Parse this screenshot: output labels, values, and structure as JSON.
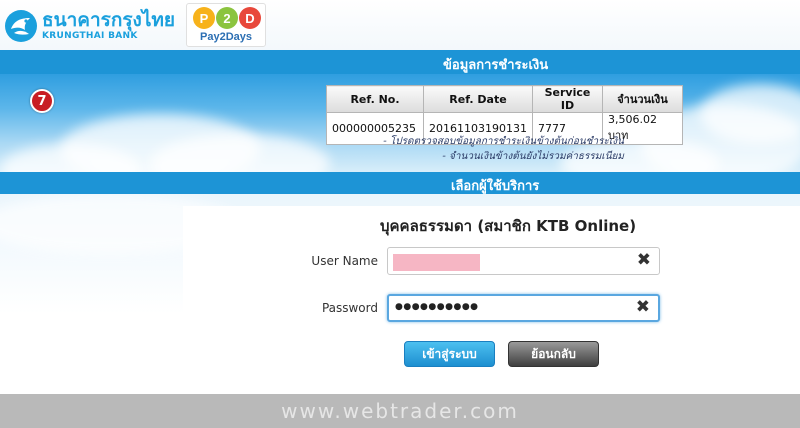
{
  "header": {
    "bank_name_th": "ธนาคารกรุงไทย",
    "bank_name_en": "KRUNGTHAI BANK",
    "p2d_letters": [
      "P",
      "2",
      "D"
    ],
    "p2d_colors": [
      "#f7b21b",
      "#8bc43f",
      "#e8483b"
    ],
    "p2d_tagline": "Pay2Days"
  },
  "payment": {
    "section_title": "ข้อมูลการชำระเงิน",
    "step_number": "7",
    "table": {
      "headers": [
        "Ref. No.",
        "Ref. Date",
        "Service ID",
        "จำนวนเงิน"
      ],
      "row": [
        "000000005235",
        "20161103190131",
        "7777",
        "3,506.02 บาท"
      ]
    },
    "notes": [
      "- โปรดตรวจสอบข้อมูลการชำระเงินข้างต้นก่อนชำระเงิน",
      "- จำนวนเงินข้างต้นยังไม่รวมค่าธรรมเนียม"
    ]
  },
  "service": {
    "section_title": "เลือกผู้ใช้บริการ",
    "form_title": "บุคคลธรรมดา (สมาชิก KTB Online)",
    "username_label": "User Name",
    "password_label": "Password",
    "password_value": "●●●●●●●●●●",
    "clear_glyph": "✖",
    "login_button": "เข้าสู่ระบบ",
    "back_button": "ย้อนกลับ"
  },
  "footer": {
    "watermark": "www.webtrader.com"
  },
  "colors": {
    "brand_blue": "#1d94d6",
    "step_red": "#c81d24"
  }
}
